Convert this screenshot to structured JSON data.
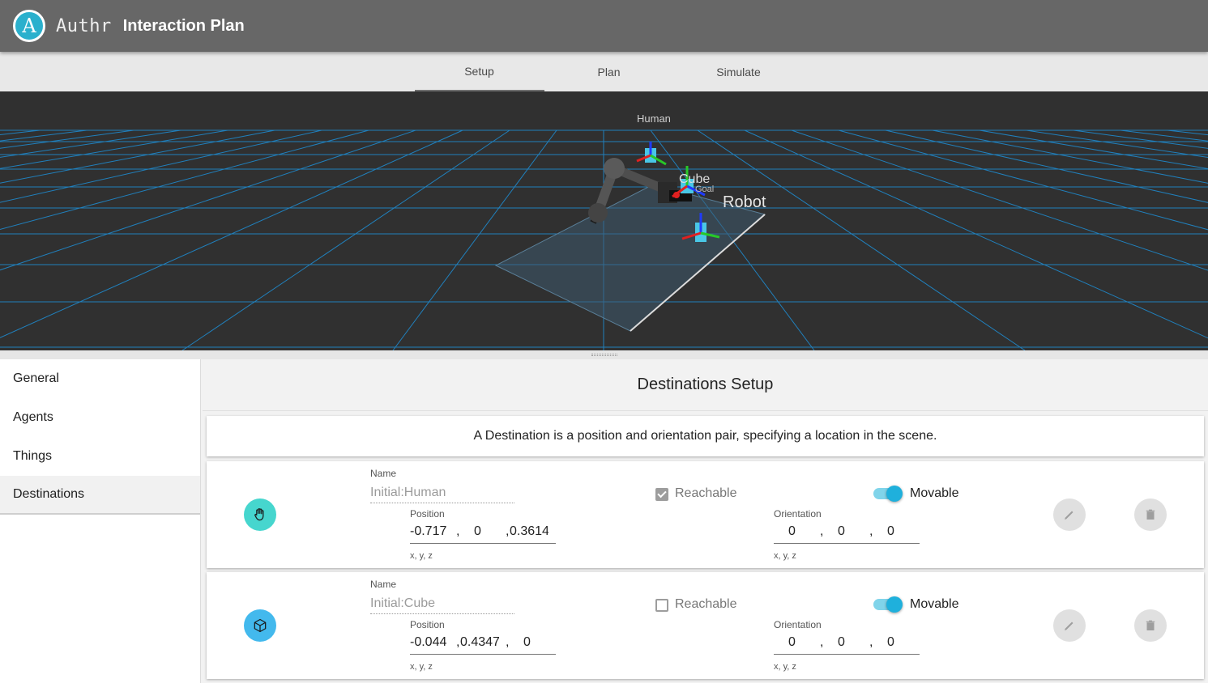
{
  "header": {
    "logo_letter": "A",
    "brand": "Authr",
    "title": "Interaction Plan"
  },
  "tabs": [
    {
      "label": "Setup",
      "active": true
    },
    {
      "label": "Plan",
      "active": false
    },
    {
      "label": "Simulate",
      "active": false
    }
  ],
  "scene": {
    "labels": {
      "human": "Human",
      "robot": "Robot",
      "cube": "Cube",
      "goal": "Goal"
    },
    "colors": {
      "background": "#303030",
      "grid": "#1e8fd6"
    }
  },
  "sidebar": {
    "items": [
      {
        "label": "General",
        "active": false
      },
      {
        "label": "Agents",
        "active": false
      },
      {
        "label": "Things",
        "active": false
      },
      {
        "label": "Destinations",
        "active": true
      }
    ]
  },
  "main": {
    "title": "Destinations Setup",
    "description": "A Destination is a position and orientation pair, specifying a location in the scene."
  },
  "field_labels": {
    "name": "Name",
    "position": "Position",
    "orientation": "Orientation",
    "xyz": "x, y, z",
    "reachable": "Reachable",
    "movable": "Movable"
  },
  "destinations": [
    {
      "icon": "hand-icon",
      "color": "#46d6ce",
      "name": "Initial:Human",
      "position": [
        "-0.717",
        "0",
        "0.3614"
      ],
      "orientation": [
        "0",
        "0",
        "0"
      ],
      "reachable": true,
      "movable": true
    },
    {
      "icon": "cube-icon",
      "color": "#43b9ed",
      "name": "Initial:Cube",
      "position": [
        "-0.044",
        "0.4347",
        "0"
      ],
      "orientation": [
        "0",
        "0",
        "0"
      ],
      "reachable": false,
      "movable": true
    }
  ],
  "punct": {
    "comma": ","
  },
  "accent": "#1fb0dc"
}
